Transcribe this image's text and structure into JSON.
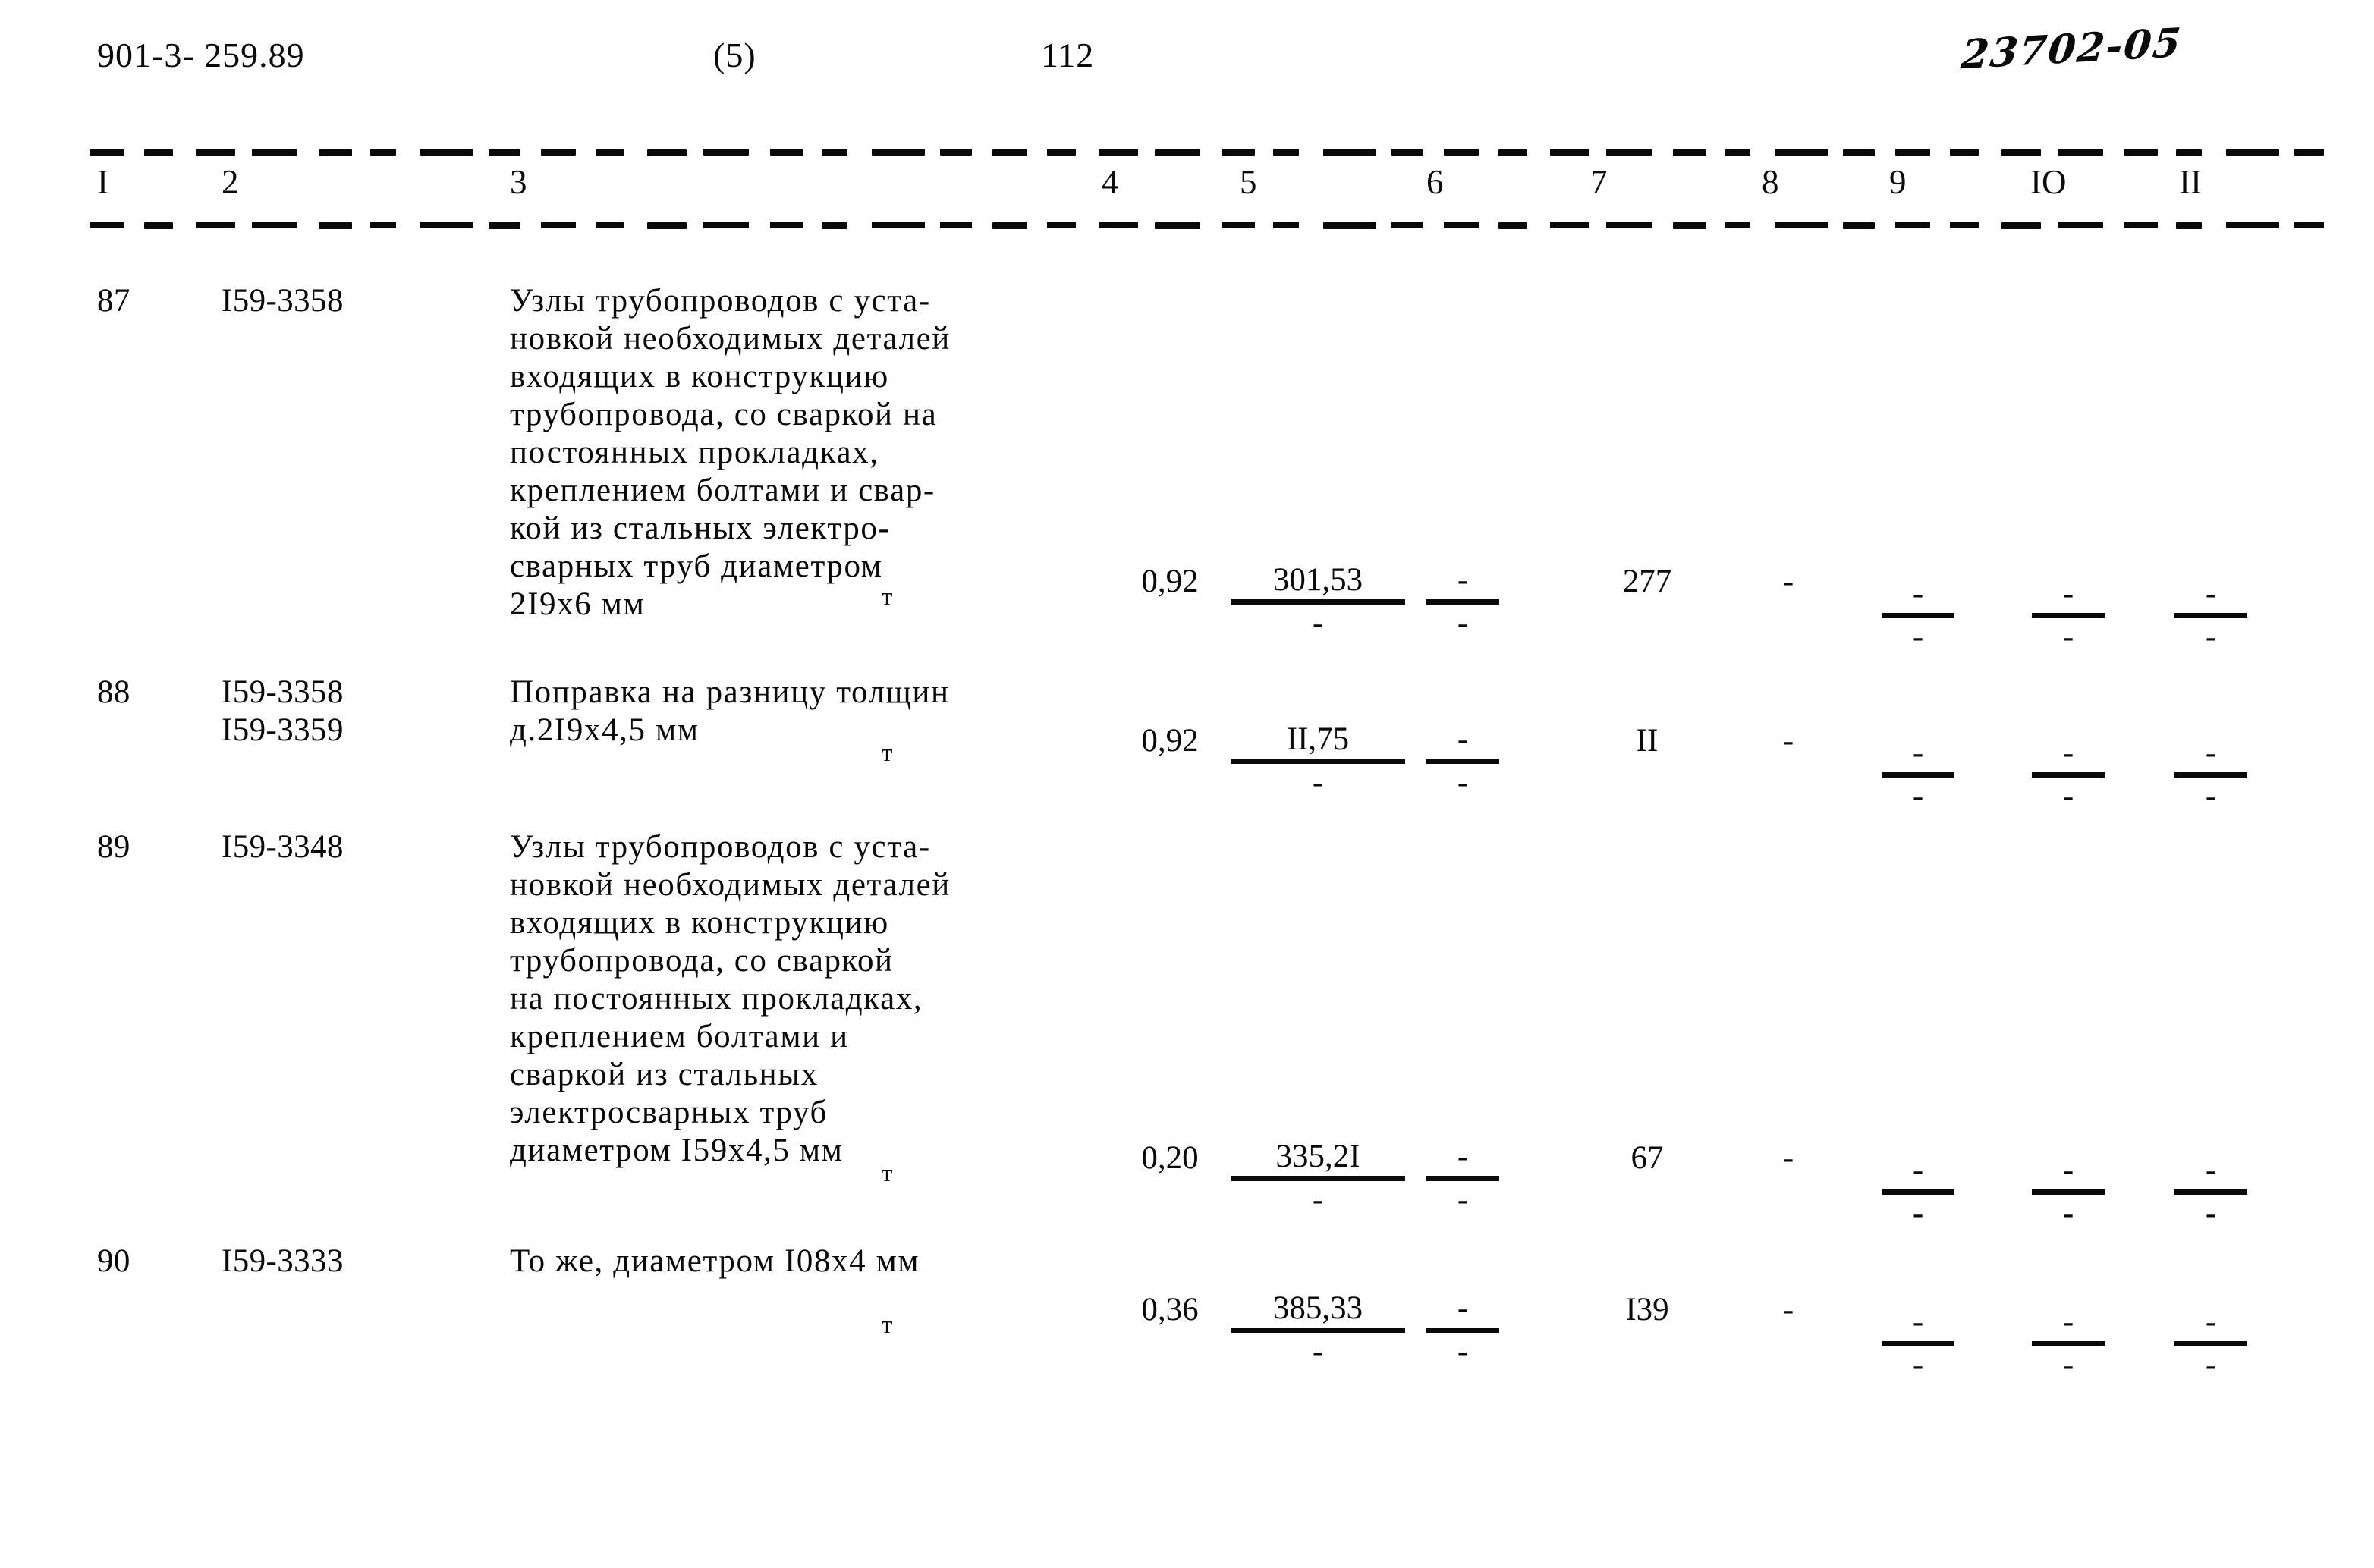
{
  "header": {
    "document_code": "901-3- 259.89",
    "part": "(5)",
    "page_number": "112",
    "handwritten_mark": "23702-05"
  },
  "table": {
    "column_headers": [
      "I",
      "2",
      "3",
      "4",
      "5",
      "6",
      "7",
      "8",
      "9",
      "IO",
      "II"
    ],
    "rows": [
      {
        "num": "87",
        "code": "I59-3358",
        "description": "Узлы трубопроводов с уста-\nновкой необходимых деталей\nвходящих в конструкцию\nтрубопровода, со сваркой на\nпостоянных прокладках,\nкреплением болтами и свар-\nкой из стальных электро-\nсварных труб диаметром\n2I9х6 мм",
        "unit": "т",
        "col4": "0,92",
        "col5_top": "301,53",
        "col5_bot": "-",
        "col6_top": "-",
        "col6_bot": "-",
        "col7": "277",
        "col8": "-",
        "col9_top": "-",
        "col9_bot": "-",
        "col10_top": "-",
        "col10_bot": "-",
        "col11_top": "-",
        "col11_bot": "-"
      },
      {
        "num": "88",
        "code": "I59-3358\nI59-3359",
        "description": "Поправка на разницу толщин\nд.2I9х4,5 мм",
        "unit": "т",
        "col4": "0,92",
        "col5_top": "II,75",
        "col5_bot": "-",
        "col6_top": "-",
        "col6_bot": "-",
        "col7": "II",
        "col8": "-",
        "col9_top": "-",
        "col9_bot": "-",
        "col10_top": "-",
        "col10_bot": "-",
        "col11_top": "-",
        "col11_bot": "-"
      },
      {
        "num": "89",
        "code": "I59-3348",
        "description": "Узлы трубопроводов с уста-\nновкой необходимых деталей\nвходящих в конструкцию\nтрубопровода, со сваркой\nна постоянных прокладках,\nкреплением болтами и\nсваркой из стальных\nэлектросварных труб\nдиаметром I59х4,5 мм",
        "unit": "т",
        "col4": "0,20",
        "col5_top": "335,2I",
        "col5_bot": "-",
        "col6_top": "-",
        "col6_bot": "-",
        "col7": "67",
        "col8": "-",
        "col9_top": "-",
        "col9_bot": "-",
        "col10_top": "-",
        "col10_bot": "-",
        "col11_top": "-",
        "col11_bot": "-"
      },
      {
        "num": "90",
        "code": "I59-3333",
        "description": "То же, диаметром I08х4 мм",
        "unit": "т",
        "col4": "0,36",
        "col5_top": "385,33",
        "col5_bot": "-",
        "col6_top": "-",
        "col6_bot": "-",
        "col7": "I39",
        "col8": "-",
        "col9_top": "-",
        "col9_bot": "-",
        "col10_top": "-",
        "col10_bot": "-",
        "col11_top": "-",
        "col11_bot": "-"
      }
    ]
  }
}
